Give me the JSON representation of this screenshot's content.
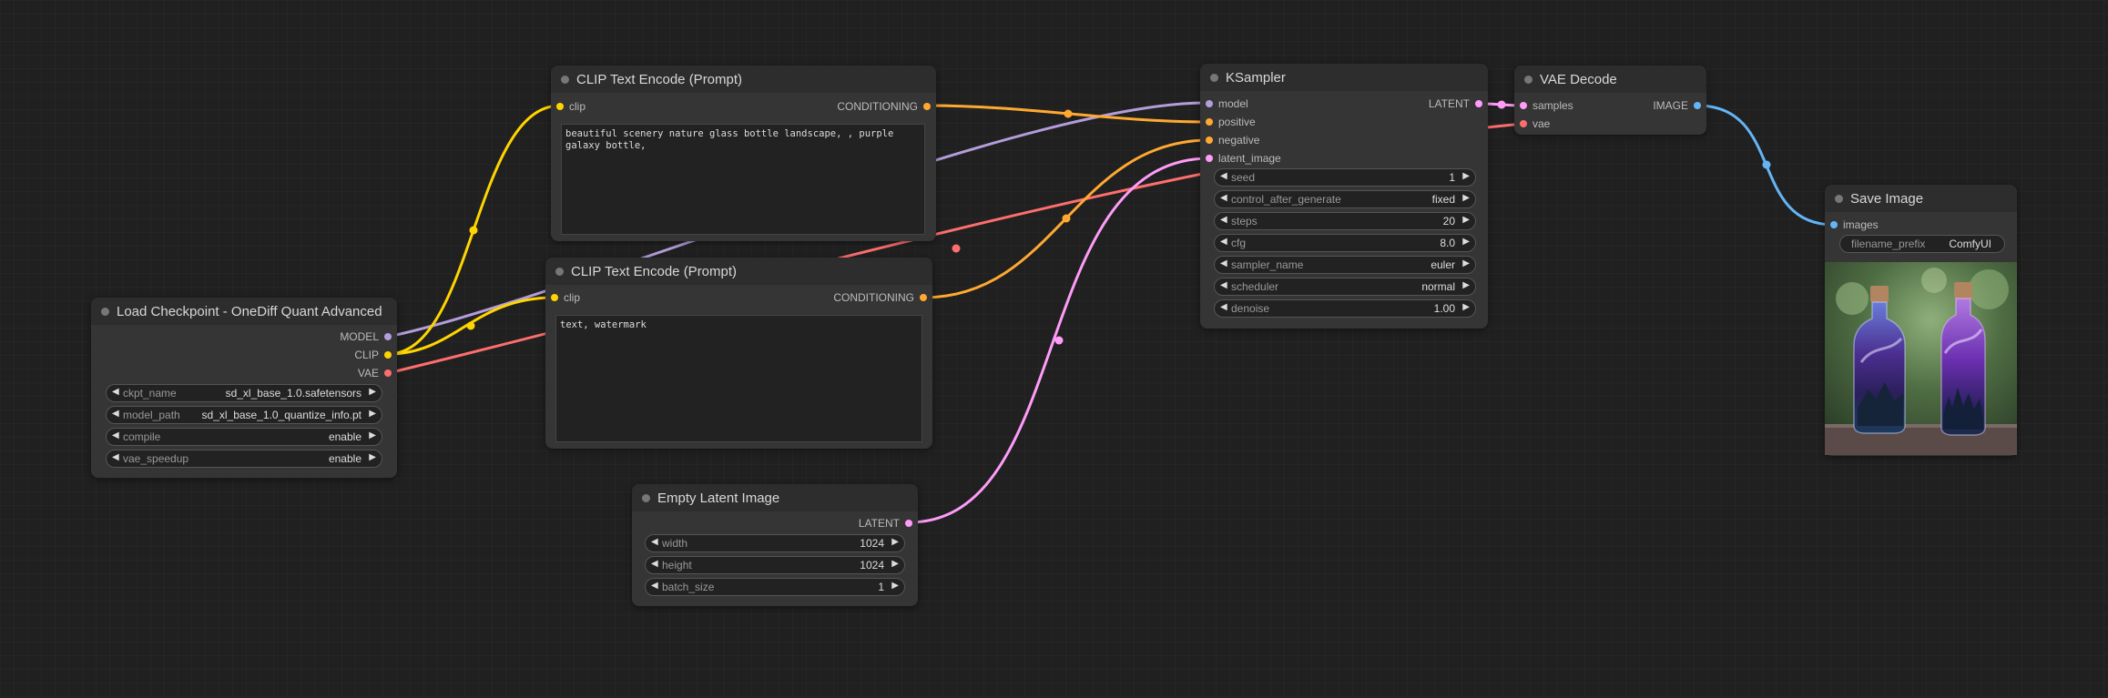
{
  "colors": {
    "model": "#b39ddb",
    "clip": "#ffd500",
    "vae": "#ff6e6e",
    "conditioning": "#ffa931",
    "latent": "#ff9cf9",
    "image": "#64b5f6"
  },
  "nodes": {
    "load_checkpoint": {
      "title": "Load Checkpoint - OneDiff Quant Advanced",
      "outputs": {
        "model": "MODEL",
        "clip": "CLIP",
        "vae": "VAE"
      },
      "widgets": [
        {
          "name": "ckpt_name",
          "value": "sd_xl_base_1.0.safetensors"
        },
        {
          "name": "model_path",
          "value": "sd_xl_base_1.0_quantize_info.pt"
        },
        {
          "name": "compile",
          "value": "enable"
        },
        {
          "name": "vae_speedup",
          "value": "enable"
        }
      ]
    },
    "clip_positive": {
      "title": "CLIP Text Encode (Prompt)",
      "input": "clip",
      "output": "CONDITIONING",
      "text": "beautiful scenery nature glass bottle landscape, , purple galaxy bottle,"
    },
    "clip_negative": {
      "title": "CLIP Text Encode (Prompt)",
      "input": "clip",
      "output": "CONDITIONING",
      "text": "text, watermark"
    },
    "empty_latent": {
      "title": "Empty Latent Image",
      "output": "LATENT",
      "widgets": [
        {
          "name": "width",
          "value": "1024"
        },
        {
          "name": "height",
          "value": "1024"
        },
        {
          "name": "batch_size",
          "value": "1"
        }
      ]
    },
    "ksampler": {
      "title": "KSampler",
      "inputs": {
        "model": "model",
        "positive": "positive",
        "negative": "negative",
        "latent_image": "latent_image"
      },
      "output": "LATENT",
      "widgets": [
        {
          "name": "seed",
          "value": "1"
        },
        {
          "name": "control_after_generate",
          "value": "fixed"
        },
        {
          "name": "steps",
          "value": "20"
        },
        {
          "name": "cfg",
          "value": "8.0"
        },
        {
          "name": "sampler_name",
          "value": "euler"
        },
        {
          "name": "scheduler",
          "value": "normal"
        },
        {
          "name": "denoise",
          "value": "1.00"
        }
      ]
    },
    "vae_decode": {
      "title": "VAE Decode",
      "inputs": {
        "samples": "samples",
        "vae": "vae"
      },
      "output": "IMAGE"
    },
    "save_image": {
      "title": "Save Image",
      "input": "images",
      "widgets": [
        {
          "name": "filename_prefix",
          "value": "ComfyUI"
        }
      ]
    }
  }
}
